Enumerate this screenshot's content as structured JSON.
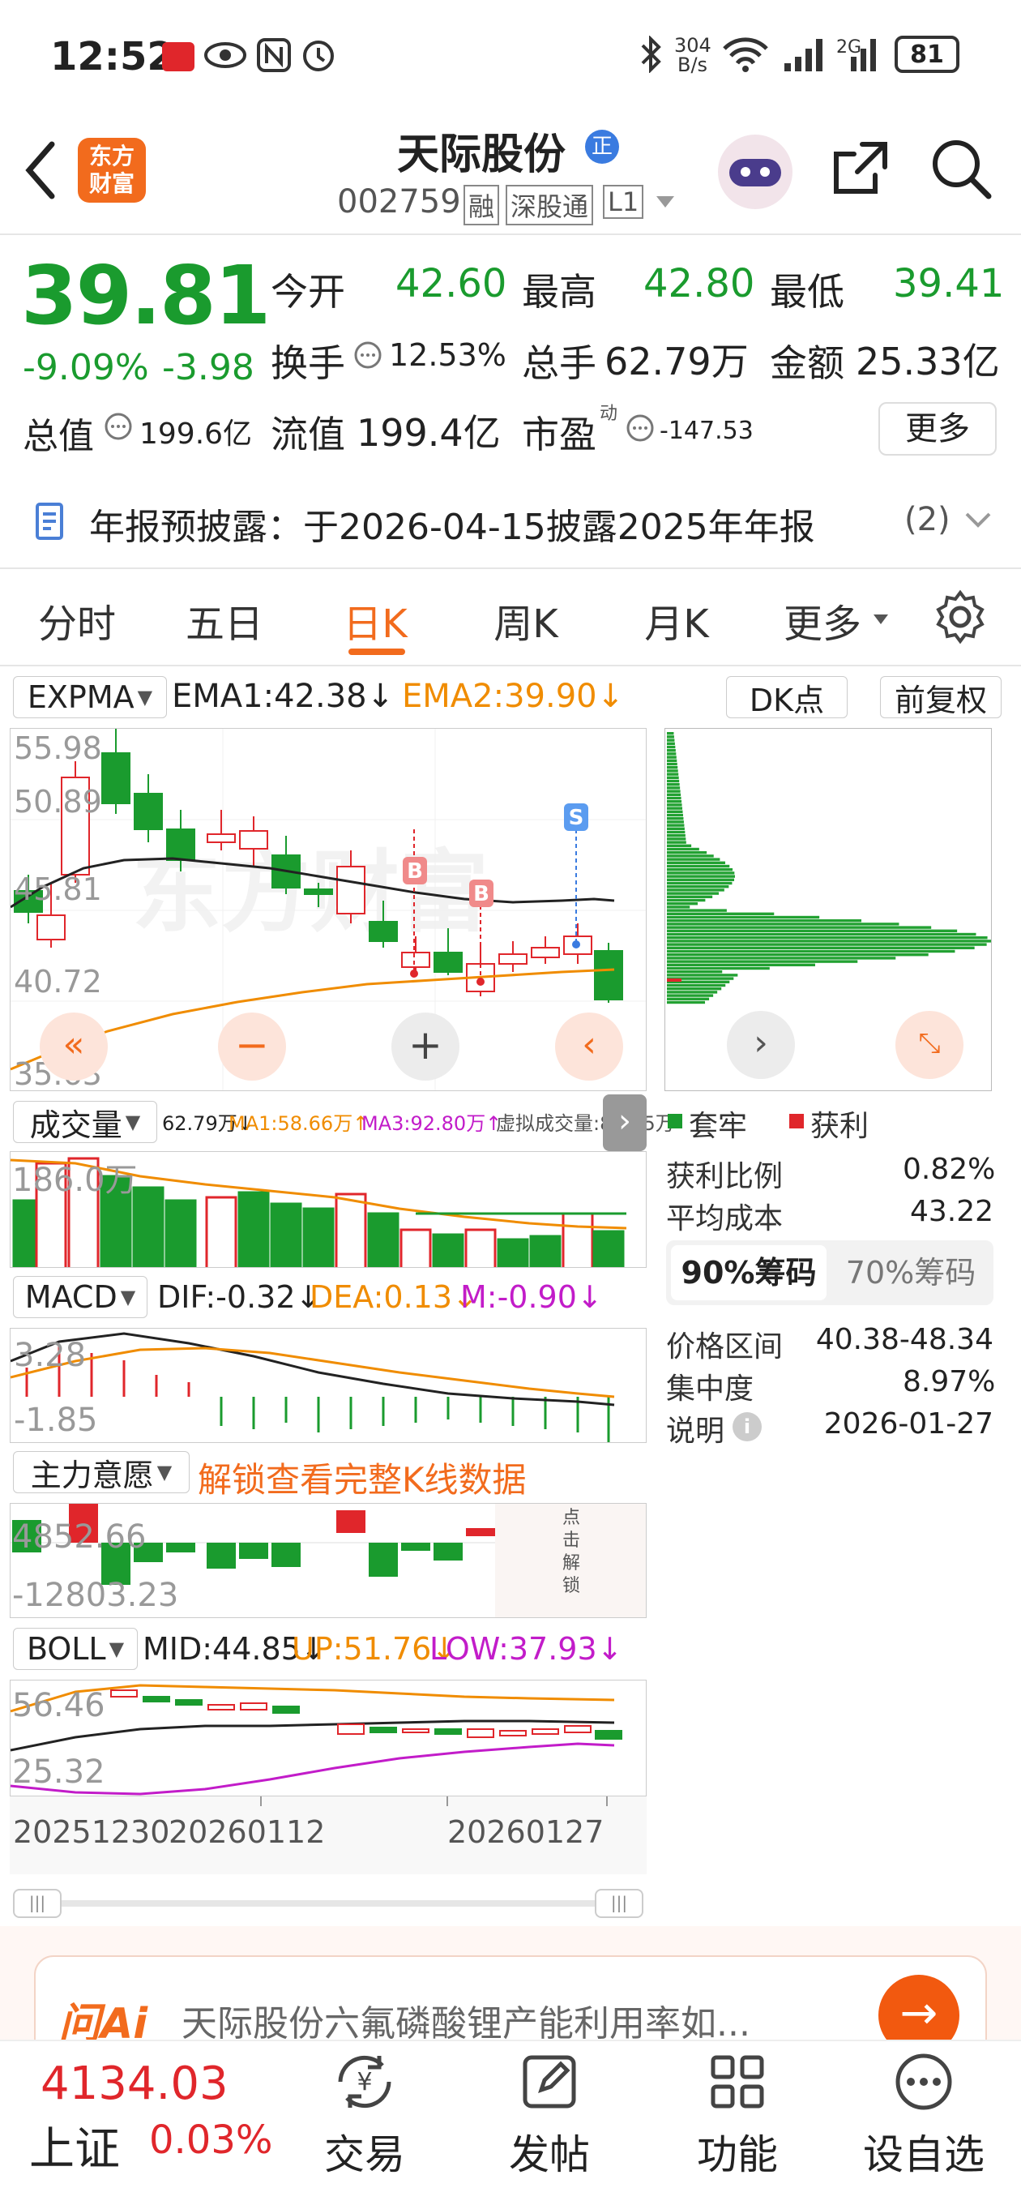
{
  "status_bar": {
    "time": "12:52",
    "net_speed_top": "304",
    "net_speed_bottom": "B/s",
    "battery": "81",
    "signal_tag": "2G",
    "wifi_tag": "6"
  },
  "header": {
    "app_logo_top": "东方",
    "app_logo_bottom": "财富",
    "stock_name": "天际股份",
    "name_badge": "正",
    "stock_code": "002759",
    "tags": [
      "融",
      "深股通",
      "L1"
    ]
  },
  "quote": {
    "price": "39.81",
    "change_pct": "-9.09%",
    "change_abs": "-3.98",
    "open_label": "今开",
    "open": "42.60",
    "high_label": "最高",
    "high": "42.80",
    "low_label": "最低",
    "low": "39.41",
    "turnover_label": "换手",
    "turnover": "12.53%",
    "volume_label": "总手",
    "volume": "62.79万",
    "amount_label": "金额",
    "amount": "25.33亿",
    "mktcap_label": "总值",
    "mktcap": "199.6亿",
    "float_label": "流值",
    "float_cap": "199.4亿",
    "pe_label": "市盈",
    "pe_sup": "动",
    "pe": "-147.53",
    "more_button": "更多"
  },
  "notice": {
    "text": "年报预披露：于2026-04-15披露2025年年报",
    "count": "(2)"
  },
  "tabs": [
    "分时",
    "五日",
    "日K",
    "周K",
    "月K",
    "更多"
  ],
  "active_tab": "日K",
  "main_chart": {
    "indicator": "EXPMA",
    "ema1": "EMA1:42.38↓",
    "ema2": "EMA2:39.90↓",
    "dk_button": "DK点",
    "adjust_button": "前复权",
    "y_labels": [
      "55.98",
      "50.89",
      "45.81",
      "40.72",
      "35.63"
    ],
    "signals": [
      "B",
      "B",
      "S"
    ]
  },
  "volume_chart": {
    "indicator": "成交量",
    "vol": "62.79万↓",
    "ma1": "MA1:58.66万↑",
    "ma3": "MA3:92.80万↑",
    "virtual": "虚拟成交量:84.75万",
    "y_label": "186.0万"
  },
  "macd_chart": {
    "indicator": "MACD",
    "dif": "DIF:-0.32↓",
    "dea": "DEA:0.13↓",
    "m": "M:-0.90↓",
    "y_labels": [
      "3.28",
      "-1.85"
    ]
  },
  "flow_chart": {
    "indicator": "主力意愿",
    "unlock_text": "解锁查看完整K线数据",
    "y_labels": [
      "4852.66",
      "-12803.23"
    ],
    "unlock_side": [
      "点",
      "击",
      "解",
      "锁"
    ]
  },
  "boll_chart": {
    "indicator": "BOLL",
    "mid": "MID:44.85↓",
    "up": "UP:51.76↓",
    "low": "LOW:37.93↓",
    "y_labels": [
      "56.46",
      "25.32"
    ]
  },
  "dates": [
    "20251230",
    "20260112",
    "20260127"
  ],
  "chips": {
    "legend_trapped": "套牢",
    "legend_profit": "获利",
    "profit_ratio_label": "获利比例",
    "profit_ratio": "0.82%",
    "avg_cost_label": "平均成本",
    "avg_cost": "43.22",
    "tab_90": "90%筹码",
    "tab_70": "70%筹码",
    "range_label": "价格区间",
    "range": "40.38-48.34",
    "concentration_label": "集中度",
    "concentration": "8.97%",
    "note_label": "说明",
    "note": "2026-01-27"
  },
  "ai_bar": {
    "logo": "问Ai",
    "text": "天际股份六氟磷酸锂产能利用率如..."
  },
  "bottom_nav": {
    "index_value": "4134.03",
    "index_name": "上证",
    "index_change": "0.03%",
    "items": [
      "交易",
      "发帖",
      "功能",
      "设自选"
    ]
  },
  "colors": {
    "up": "#e0262b",
    "down": "#1a9b2e",
    "accent": "#f26b1d",
    "ema2": "#f08c00"
  }
}
